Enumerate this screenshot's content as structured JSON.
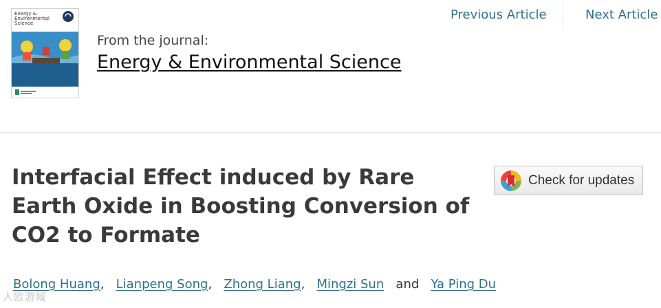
{
  "journal": {
    "cover_title": "Energy & Environmental Science",
    "from_label": "From the journal:",
    "name": "Energy & Environmental Science"
  },
  "nav": {
    "previous": "Previous Article",
    "next": "Next Article"
  },
  "article": {
    "title_line1": "Interfacial Effect induced by Rare",
    "title_line2": "Earth Oxide in Boosting Conversion of",
    "title_line3": "CO2 to Formate"
  },
  "updates_button": {
    "label": "Check for updates",
    "icon": "crossmark-icon"
  },
  "authors": {
    "names": [
      "Bolong Huang",
      "Lianpeng Song",
      "Zhong Liang",
      "Mingzi Sun",
      "Ya Ping Du"
    ],
    "separator": ",",
    "conjunction": "and"
  },
  "watermark": {
    "text": "人欧游域"
  },
  "colors": {
    "link": "#2f6f8f",
    "title": "#3a3a3a",
    "divider": "#e6e6e6"
  }
}
